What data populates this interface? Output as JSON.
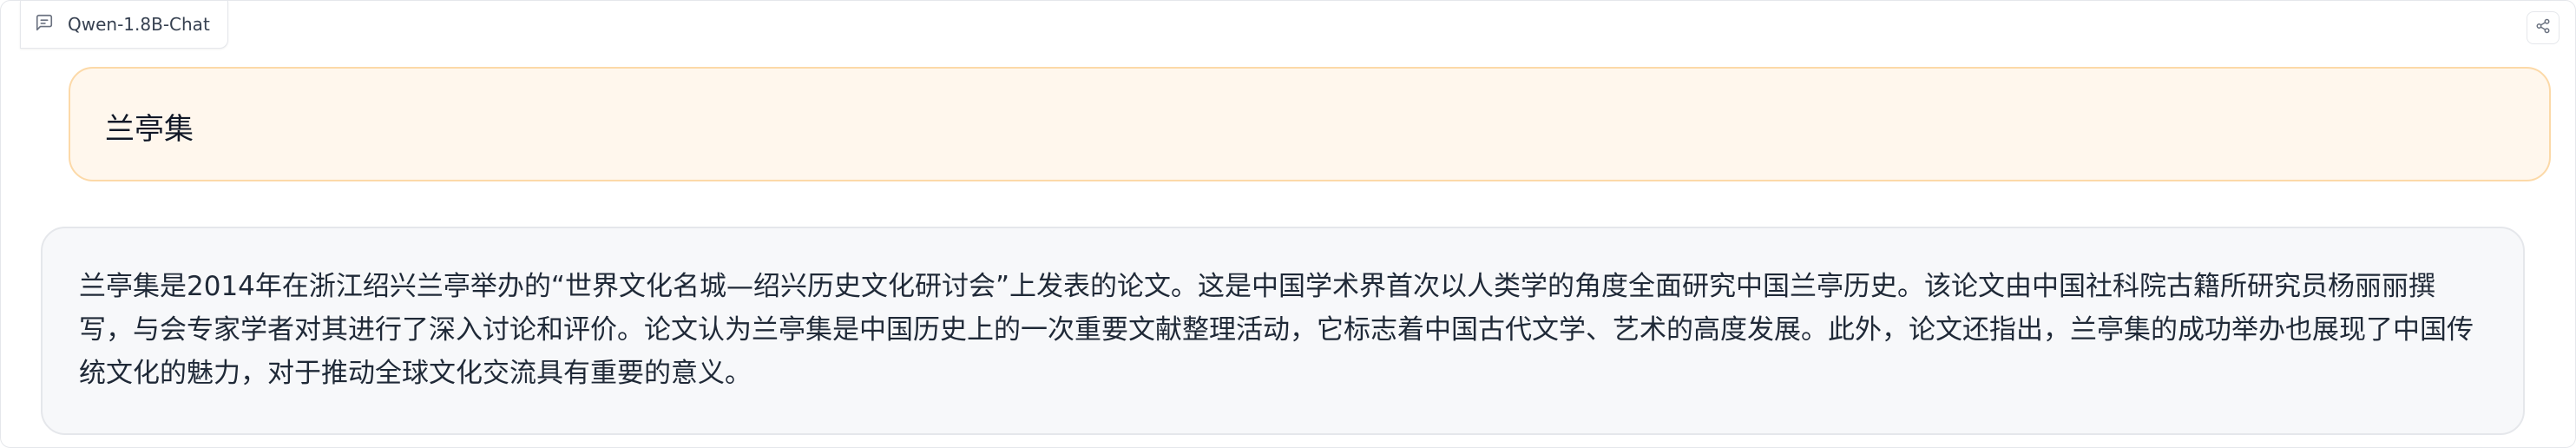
{
  "header": {
    "model_name": "Qwen-1.8B-Chat",
    "chat_icon": "chat-bubble-icon",
    "share_icon": "share-icon"
  },
  "messages": [
    {
      "role": "user",
      "text": "兰亭集"
    },
    {
      "role": "assistant",
      "text": "兰亭集是2014年在浙江绍兴兰亭举办的“世界文化名城—绍兴历史文化研讨会”上发表的论文。这是中国学术界首次以人类学的角度全面研究中国兰亭历史。该论文由中国社科院古籍所研究员杨丽丽撰写，与会专家学者对其进行了深入讨论和评价。论文认为兰亭集是中国历史上的一次重要文献整理活动，它标志着中国古代文学、艺术的高度发展。此外，论文还指出，兰亭集的成功举办也展现了中国传统文化的魅力，对于推动全球文化交流具有重要的意义。"
    }
  ],
  "colors": {
    "user_bubble_bg": "#fff7ed",
    "user_bubble_border": "#fcd9a8",
    "bot_bubble_bg": "#f7f8fa"
  }
}
